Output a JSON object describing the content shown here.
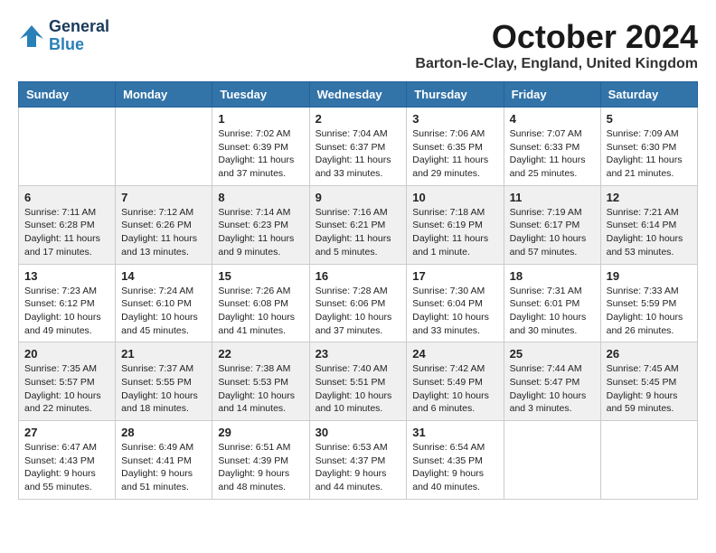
{
  "logo": {
    "line1": "General",
    "line2": "Blue"
  },
  "title": "October 2024",
  "location": "Barton-le-Clay, England, United Kingdom",
  "weekdays": [
    "Sunday",
    "Monday",
    "Tuesday",
    "Wednesday",
    "Thursday",
    "Friday",
    "Saturday"
  ],
  "weeks": [
    [
      {
        "day": "",
        "info": ""
      },
      {
        "day": "",
        "info": ""
      },
      {
        "day": "1",
        "info": "Sunrise: 7:02 AM\nSunset: 6:39 PM\nDaylight: 11 hours and 37 minutes."
      },
      {
        "day": "2",
        "info": "Sunrise: 7:04 AM\nSunset: 6:37 PM\nDaylight: 11 hours and 33 minutes."
      },
      {
        "day": "3",
        "info": "Sunrise: 7:06 AM\nSunset: 6:35 PM\nDaylight: 11 hours and 29 minutes."
      },
      {
        "day": "4",
        "info": "Sunrise: 7:07 AM\nSunset: 6:33 PM\nDaylight: 11 hours and 25 minutes."
      },
      {
        "day": "5",
        "info": "Sunrise: 7:09 AM\nSunset: 6:30 PM\nDaylight: 11 hours and 21 minutes."
      }
    ],
    [
      {
        "day": "6",
        "info": "Sunrise: 7:11 AM\nSunset: 6:28 PM\nDaylight: 11 hours and 17 minutes."
      },
      {
        "day": "7",
        "info": "Sunrise: 7:12 AM\nSunset: 6:26 PM\nDaylight: 11 hours and 13 minutes."
      },
      {
        "day": "8",
        "info": "Sunrise: 7:14 AM\nSunset: 6:23 PM\nDaylight: 11 hours and 9 minutes."
      },
      {
        "day": "9",
        "info": "Sunrise: 7:16 AM\nSunset: 6:21 PM\nDaylight: 11 hours and 5 minutes."
      },
      {
        "day": "10",
        "info": "Sunrise: 7:18 AM\nSunset: 6:19 PM\nDaylight: 11 hours and 1 minute."
      },
      {
        "day": "11",
        "info": "Sunrise: 7:19 AM\nSunset: 6:17 PM\nDaylight: 10 hours and 57 minutes."
      },
      {
        "day": "12",
        "info": "Sunrise: 7:21 AM\nSunset: 6:14 PM\nDaylight: 10 hours and 53 minutes."
      }
    ],
    [
      {
        "day": "13",
        "info": "Sunrise: 7:23 AM\nSunset: 6:12 PM\nDaylight: 10 hours and 49 minutes."
      },
      {
        "day": "14",
        "info": "Sunrise: 7:24 AM\nSunset: 6:10 PM\nDaylight: 10 hours and 45 minutes."
      },
      {
        "day": "15",
        "info": "Sunrise: 7:26 AM\nSunset: 6:08 PM\nDaylight: 10 hours and 41 minutes."
      },
      {
        "day": "16",
        "info": "Sunrise: 7:28 AM\nSunset: 6:06 PM\nDaylight: 10 hours and 37 minutes."
      },
      {
        "day": "17",
        "info": "Sunrise: 7:30 AM\nSunset: 6:04 PM\nDaylight: 10 hours and 33 minutes."
      },
      {
        "day": "18",
        "info": "Sunrise: 7:31 AM\nSunset: 6:01 PM\nDaylight: 10 hours and 30 minutes."
      },
      {
        "day": "19",
        "info": "Sunrise: 7:33 AM\nSunset: 5:59 PM\nDaylight: 10 hours and 26 minutes."
      }
    ],
    [
      {
        "day": "20",
        "info": "Sunrise: 7:35 AM\nSunset: 5:57 PM\nDaylight: 10 hours and 22 minutes."
      },
      {
        "day": "21",
        "info": "Sunrise: 7:37 AM\nSunset: 5:55 PM\nDaylight: 10 hours and 18 minutes."
      },
      {
        "day": "22",
        "info": "Sunrise: 7:38 AM\nSunset: 5:53 PM\nDaylight: 10 hours and 14 minutes."
      },
      {
        "day": "23",
        "info": "Sunrise: 7:40 AM\nSunset: 5:51 PM\nDaylight: 10 hours and 10 minutes."
      },
      {
        "day": "24",
        "info": "Sunrise: 7:42 AM\nSunset: 5:49 PM\nDaylight: 10 hours and 6 minutes."
      },
      {
        "day": "25",
        "info": "Sunrise: 7:44 AM\nSunset: 5:47 PM\nDaylight: 10 hours and 3 minutes."
      },
      {
        "day": "26",
        "info": "Sunrise: 7:45 AM\nSunset: 5:45 PM\nDaylight: 9 hours and 59 minutes."
      }
    ],
    [
      {
        "day": "27",
        "info": "Sunrise: 6:47 AM\nSunset: 4:43 PM\nDaylight: 9 hours and 55 minutes."
      },
      {
        "day": "28",
        "info": "Sunrise: 6:49 AM\nSunset: 4:41 PM\nDaylight: 9 hours and 51 minutes."
      },
      {
        "day": "29",
        "info": "Sunrise: 6:51 AM\nSunset: 4:39 PM\nDaylight: 9 hours and 48 minutes."
      },
      {
        "day": "30",
        "info": "Sunrise: 6:53 AM\nSunset: 4:37 PM\nDaylight: 9 hours and 44 minutes."
      },
      {
        "day": "31",
        "info": "Sunrise: 6:54 AM\nSunset: 4:35 PM\nDaylight: 9 hours and 40 minutes."
      },
      {
        "day": "",
        "info": ""
      },
      {
        "day": "",
        "info": ""
      }
    ]
  ]
}
